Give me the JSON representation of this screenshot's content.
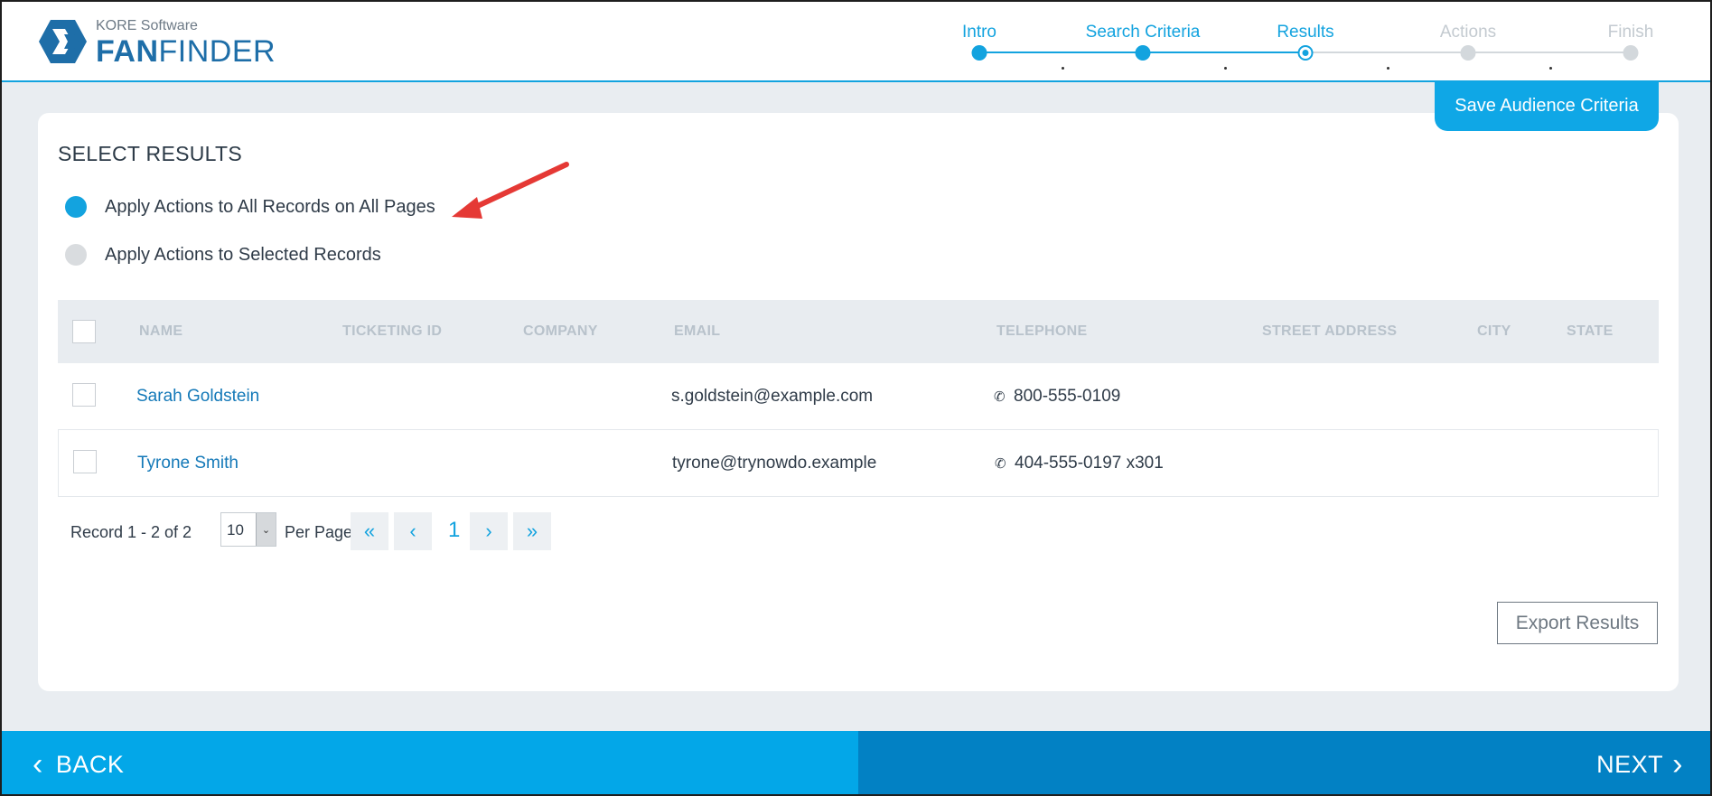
{
  "brand": {
    "company": "KORE Software",
    "product_bold": "FAN",
    "product_rest": "FINDER"
  },
  "stepper": {
    "steps": [
      {
        "label": "Intro",
        "state": "done"
      },
      {
        "label": "Search Criteria",
        "state": "done"
      },
      {
        "label": "Results",
        "state": "current"
      },
      {
        "label": "Actions",
        "state": "todo"
      },
      {
        "label": "Finish",
        "state": "todo"
      }
    ]
  },
  "card": {
    "save_label": "Save Audience Criteria",
    "title": "SELECT RESULTS",
    "options": [
      {
        "label": "Apply Actions to All Records on All Pages",
        "selected": true
      },
      {
        "label": "Apply Actions to Selected Records",
        "selected": false
      }
    ]
  },
  "table": {
    "headers": {
      "name": "NAME",
      "ticketing_id": "TICKETING ID",
      "company": "COMPANY",
      "email": "EMAIL",
      "telephone": "TELEPHONE",
      "street_address": "STREET ADDRESS",
      "city": "CITY",
      "state": "STATE"
    },
    "rows": [
      {
        "name": "Sarah Goldstein",
        "ticketing_id": "",
        "company": "",
        "email": "s.goldstein@example.com",
        "telephone": "800-555-0109",
        "street_address": "",
        "city": "",
        "state": ""
      },
      {
        "name": "Tyrone Smith",
        "ticketing_id": "",
        "company": "",
        "email": "tyrone@trynowdo.example",
        "telephone": "404-555-0197 x301",
        "street_address": "",
        "city": "",
        "state": ""
      }
    ]
  },
  "pager": {
    "record_text": "Record 1 - 2 of 2",
    "per_page_value": "10",
    "per_page_label": "Per Page",
    "current_page": "1",
    "first_glyph": "«",
    "prev_glyph": "‹",
    "next_glyph": "›",
    "last_glyph": "»"
  },
  "export_label": "Export Results",
  "footer": {
    "back_label": "BACK",
    "next_label": "NEXT"
  },
  "colors": {
    "accent": "#13a3df",
    "back_bg": "#03a7e8",
    "next_bg": "#0281c4",
    "brand_blue": "#1e6ea8"
  }
}
